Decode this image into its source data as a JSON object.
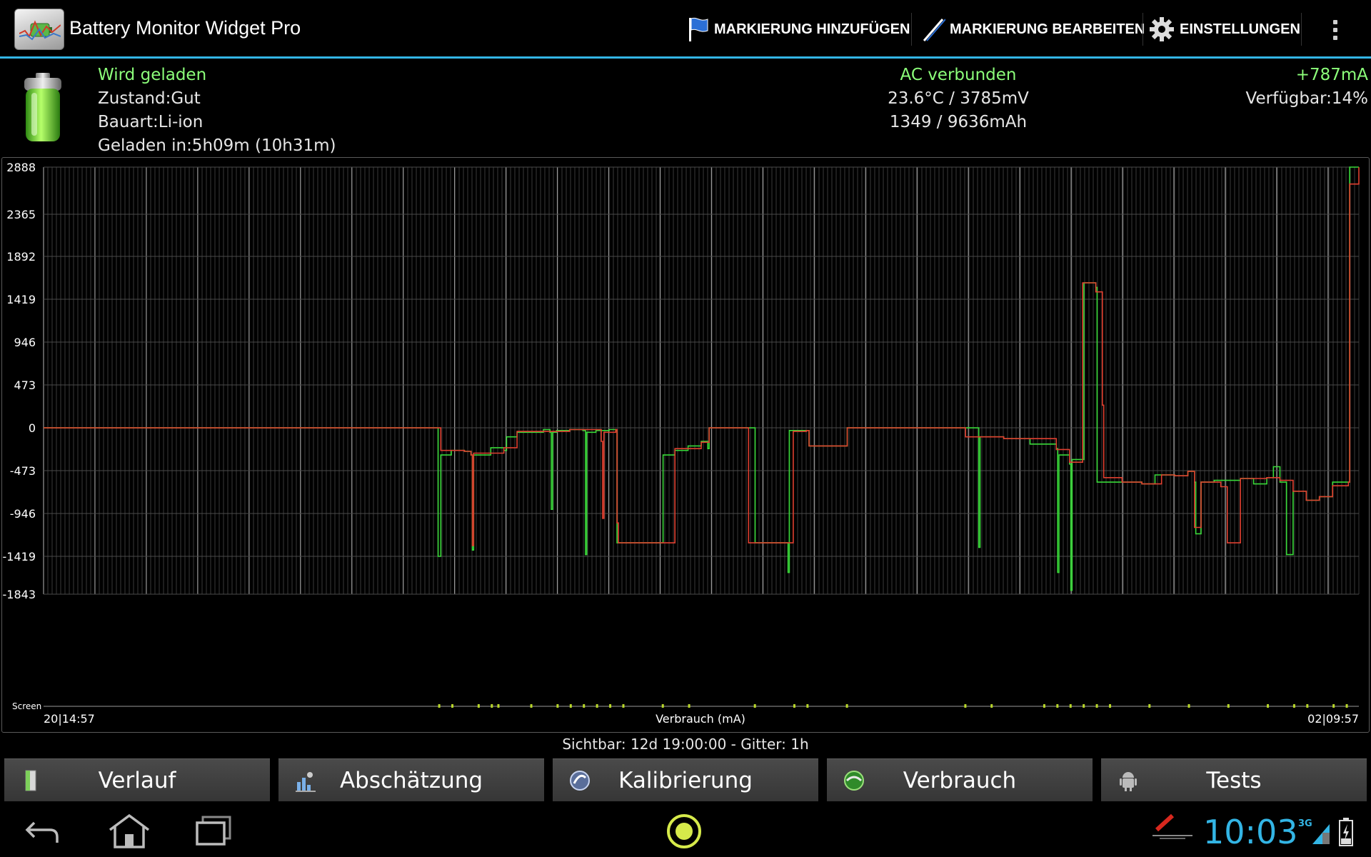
{
  "app": {
    "title": "Battery Monitor Widget Pro"
  },
  "actions": {
    "add_marker": "MARKIERUNG HINZUFÜGEN",
    "edit_marker": "MARKIERUNG BEARBEITEN",
    "settings": "EINSTELLUNGEN"
  },
  "status": {
    "state": "Wird geladen",
    "condition": "Zustand:Gut",
    "type": "Bauart:Li-ion",
    "charged_in": "Geladen in:5h09m (10h31m)",
    "power": "AC verbunden",
    "temp_voltage": "23.6°C / 3785mV",
    "capacity": "1349 / 9636mAh",
    "current": "+787mA",
    "available": "Verfügbar:14%"
  },
  "chart_data": {
    "type": "line",
    "ylabel": "Verbrauch (mA)",
    "y_ticks": [
      "2888",
      "2365",
      "1892",
      "1419",
      "946",
      "473",
      "0",
      "-473",
      "-946",
      "-1419",
      "-1843"
    ],
    "ylim": [
      -1843,
      2888
    ],
    "x_start_label": "20|14:57",
    "x_end_label": "02|09:57",
    "screen_label": "Screen",
    "grid": true,
    "series": [
      {
        "color": "#39d939",
        "points": [
          [
            0.0,
            -1
          ],
          [
            0.3,
            -1
          ],
          [
            0.3,
            -1419
          ],
          [
            0.302,
            -300
          ],
          [
            0.31,
            -250
          ],
          [
            0.32,
            -260
          ],
          [
            0.325,
            -300
          ],
          [
            0.326,
            -1350
          ],
          [
            0.327,
            -300
          ],
          [
            0.34,
            -220
          ],
          [
            0.35,
            -250
          ],
          [
            0.352,
            -100
          ],
          [
            0.36,
            -50
          ],
          [
            0.38,
            -20
          ],
          [
            0.385,
            -50
          ],
          [
            0.386,
            -900
          ],
          [
            0.387,
            -50
          ],
          [
            0.39,
            -30
          ],
          [
            0.4,
            -20
          ],
          [
            0.41,
            -30
          ],
          [
            0.412,
            -1400
          ],
          [
            0.413,
            -50
          ],
          [
            0.42,
            -30
          ],
          [
            0.43,
            -20
          ],
          [
            0.435,
            -30
          ],
          [
            0.436,
            -1270
          ],
          [
            0.47,
            -1270
          ],
          [
            0.471,
            -300
          ],
          [
            0.48,
            -250
          ],
          [
            0.49,
            -200
          ],
          [
            0.5,
            -150
          ],
          [
            0.505,
            -230
          ],
          [
            0.506,
            -1
          ],
          [
            0.54,
            -1
          ],
          [
            0.541,
            -1270
          ],
          [
            0.565,
            -1270
          ],
          [
            0.566,
            -1600
          ],
          [
            0.567,
            -30
          ],
          [
            0.58,
            -30
          ],
          [
            0.582,
            -200
          ],
          [
            0.61,
            -200
          ],
          [
            0.611,
            -1
          ],
          [
            0.7,
            -1
          ],
          [
            0.71,
            -1
          ],
          [
            0.711,
            -1320
          ],
          [
            0.712,
            -100
          ],
          [
            0.73,
            -120
          ],
          [
            0.75,
            -180
          ],
          [
            0.77,
            -230
          ],
          [
            0.771,
            -1600
          ],
          [
            0.772,
            -300
          ],
          [
            0.78,
            -400
          ],
          [
            0.781,
            -1800
          ],
          [
            0.782,
            -350
          ],
          [
            0.79,
            -350
          ],
          [
            0.791,
            1600
          ],
          [
            0.8,
            1550
          ],
          [
            0.801,
            -600
          ],
          [
            0.82,
            -600
          ],
          [
            0.835,
            -620
          ],
          [
            0.845,
            -520
          ],
          [
            0.86,
            -530
          ],
          [
            0.87,
            -480
          ],
          [
            0.875,
            -600
          ],
          [
            0.876,
            -1170
          ],
          [
            0.88,
            -600
          ],
          [
            0.89,
            -580
          ],
          [
            0.91,
            -560
          ],
          [
            0.92,
            -620
          ],
          [
            0.93,
            -550
          ],
          [
            0.935,
            -430
          ],
          [
            0.94,
            -600
          ],
          [
            0.945,
            -1400
          ],
          [
            0.95,
            -700
          ],
          [
            0.96,
            -800
          ],
          [
            0.97,
            -760
          ],
          [
            0.98,
            -600
          ],
          [
            0.992,
            -600
          ],
          [
            0.993,
            2888
          ],
          [
            1.0,
            2888
          ]
        ]
      },
      {
        "color": "#e04030",
        "points": [
          [
            0.0,
            -1
          ],
          [
            0.3,
            -1
          ],
          [
            0.302,
            -250
          ],
          [
            0.32,
            -260
          ],
          [
            0.325,
            -300
          ],
          [
            0.326,
            -1300
          ],
          [
            0.327,
            -280
          ],
          [
            0.35,
            -220
          ],
          [
            0.36,
            -40
          ],
          [
            0.4,
            -20
          ],
          [
            0.42,
            -20
          ],
          [
            0.424,
            -150
          ],
          [
            0.425,
            -1000
          ],
          [
            0.426,
            -50
          ],
          [
            0.435,
            -20
          ],
          [
            0.436,
            -1050
          ],
          [
            0.437,
            -1270
          ],
          [
            0.47,
            -1270
          ],
          [
            0.48,
            -230
          ],
          [
            0.5,
            -160
          ],
          [
            0.506,
            -1
          ],
          [
            0.535,
            -1
          ],
          [
            0.536,
            -1270
          ],
          [
            0.565,
            -1270
          ],
          [
            0.57,
            -40
          ],
          [
            0.58,
            -30
          ],
          [
            0.582,
            -200
          ],
          [
            0.61,
            -200
          ],
          [
            0.611,
            -1
          ],
          [
            0.7,
            -1
          ],
          [
            0.701,
            -100
          ],
          [
            0.73,
            -120
          ],
          [
            0.77,
            -240
          ],
          [
            0.78,
            -380
          ],
          [
            0.79,
            1600
          ],
          [
            0.8,
            1500
          ],
          [
            0.805,
            250
          ],
          [
            0.806,
            -550
          ],
          [
            0.82,
            -600
          ],
          [
            0.835,
            -620
          ],
          [
            0.85,
            -520
          ],
          [
            0.86,
            -530
          ],
          [
            0.87,
            -480
          ],
          [
            0.875,
            -1100
          ],
          [
            0.88,
            -600
          ],
          [
            0.895,
            -650
          ],
          [
            0.9,
            -1270
          ],
          [
            0.91,
            -560
          ],
          [
            0.93,
            -550
          ],
          [
            0.94,
            -580
          ],
          [
            0.95,
            -700
          ],
          [
            0.96,
            -800
          ],
          [
            0.97,
            -760
          ],
          [
            0.98,
            -640
          ],
          [
            0.992,
            -600
          ],
          [
            0.993,
            2700
          ],
          [
            1.0,
            2888
          ]
        ]
      }
    ]
  },
  "visible_info": "Sichtbar: 12d 19:00:00 - Gitter: 1h",
  "tabs": [
    {
      "label": "Verlauf"
    },
    {
      "label": "Abschätzung"
    },
    {
      "label": "Kalibrierung"
    },
    {
      "label": "Verbrauch"
    },
    {
      "label": "Tests"
    }
  ],
  "system": {
    "clock": "10:03",
    "network": "3G"
  },
  "colors": {
    "accent": "#33b5e5",
    "positive": "#8cff7a",
    "charge_line": "#39d939",
    "discharge_line": "#e04030"
  }
}
